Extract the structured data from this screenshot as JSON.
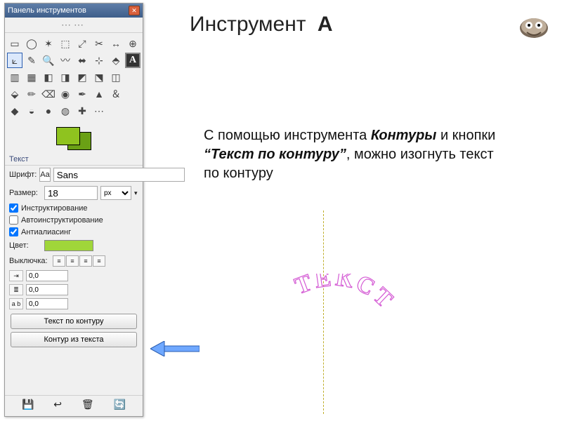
{
  "panel": {
    "title": "Панель инструментов",
    "section_text": "Текст",
    "font_label": "Шрифт:",
    "font_btn": "Aa",
    "font_name": "Sans",
    "size_label": "Размер:",
    "size_value": "18",
    "unit": "px",
    "chk_hinting": "Инструктирование",
    "chk_autohint": "Автоинструктирование",
    "chk_antialias": "Антиалиасинг",
    "color_label": "Цвет:",
    "justify_label": "Выключка:",
    "indent_value": "0,0",
    "line_value": "0,0",
    "letter_value": "0,0",
    "btn_text_along_path": "Текст по контуру",
    "btn_path_from_text": "Контур из текста",
    "color_hex": "#a0d63a",
    "fg_color": "#8fc31f",
    "tools": [
      "▭",
      "◯",
      "✶",
      "⬚",
      "⤢",
      "✂",
      "↔",
      "⊕",
      "⟀",
      "✎",
      "🔍",
      "〰",
      "⬌",
      "⊹",
      "⬘",
      "A",
      "▥",
      "▦",
      "◧",
      "◨",
      "◩",
      "⬔",
      "◫",
      "",
      "⬙",
      "✏",
      "⌫",
      "◉",
      "✒",
      "▲",
      "＆",
      "",
      "◆",
      "◒",
      "●",
      "◍",
      "✚",
      "⋯",
      "",
      ""
    ]
  },
  "content": {
    "heading_main": "Инструмент",
    "heading_A": "А",
    "desc_pre": "С помощью инструмента ",
    "desc_tool": "Контуры",
    "desc_mid": " и кнопки ",
    "desc_btn": "“Текст по контуру”",
    "desc_post": ", можно изогнуть текст по контуру",
    "curved_word": "ТЕКСТ"
  }
}
